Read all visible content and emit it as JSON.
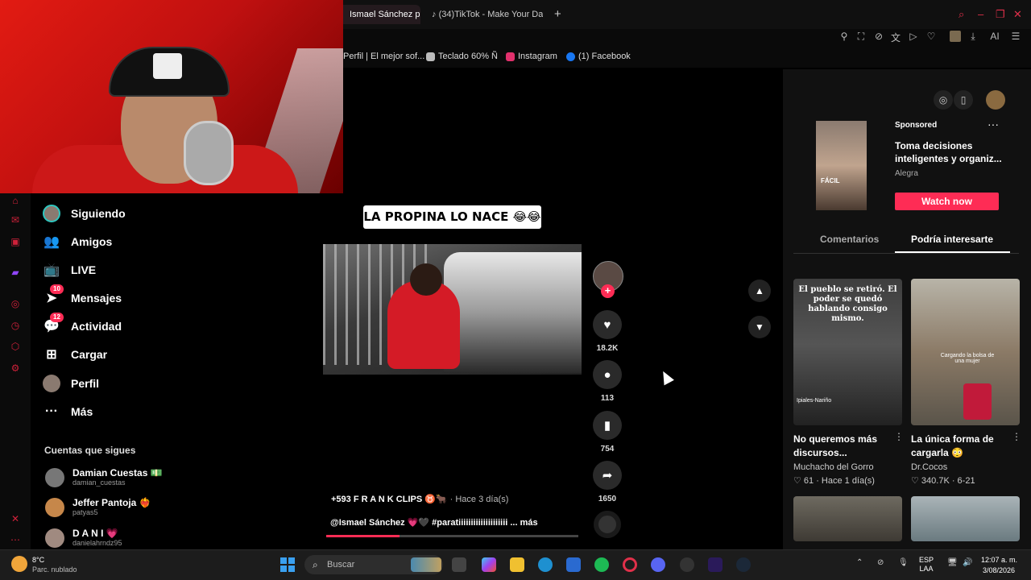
{
  "browser": {
    "tabs": [
      {
        "label": "Ismael Sánchez propina"
      },
      {
        "label": "(34)TikTok - Make Your Da"
      }
    ],
    "new_tab": "+",
    "bookmarks": [
      {
        "label": "Perfil | El mejor sof...",
        "color": "#444444"
      },
      {
        "label": "Teclado 60% Ñ",
        "color": "#bbbbbb"
      },
      {
        "label": "Instagram",
        "color": "#e1306c"
      },
      {
        "label": "(1) Facebook",
        "color": "#1877f2"
      }
    ],
    "toolbar_ai": "AI",
    "accent": "#e0304a"
  },
  "nav": {
    "items": [
      {
        "label": "Siguiendo",
        "icon": "avatar-icon"
      },
      {
        "label": "Amigos",
        "icon": "friends-icon"
      },
      {
        "label": "LIVE",
        "icon": "live-icon"
      },
      {
        "label": "Mensajes",
        "icon": "messages-icon",
        "badge": "10"
      },
      {
        "label": "Actividad",
        "icon": "activity-icon",
        "badge": "12"
      },
      {
        "label": "Cargar",
        "icon": "upload-icon"
      },
      {
        "label": "Perfil",
        "icon": "profile-icon"
      },
      {
        "label": "Más",
        "icon": "more-icon"
      }
    ],
    "following_title": "Cuentas que sigues",
    "accounts": [
      {
        "name": "Damian Cuestas 💵",
        "handle": "damian_cuestas"
      },
      {
        "name": "Jeffer Pantoja ❤️‍🔥",
        "handle": "patyas5"
      },
      {
        "name": "D A N I 💗",
        "handle": "danielahrndz95"
      }
    ]
  },
  "video": {
    "overlay_title": "LA PROPINA LO NACE 😂😂",
    "author": "+593 F R A N K CLIPS ♉🐂",
    "time": "· Hace 3 día(s)",
    "caption": "@Ismael Sánchez 💗🖤 #paratiiiiiiiiiiiiiiiiiiii ... más",
    "likes": "18.2K",
    "comments": "113",
    "saves": "754",
    "shares": "1650",
    "progress": 0.29,
    "brand_color": "#fe2c55"
  },
  "ad": {
    "sponsored": "Sponsored",
    "more": "···",
    "title": "Toma decisiones inteligentes y organiz...",
    "brand": "Alegra",
    "cta": "Watch now",
    "thumb_text": "FÁCIL"
  },
  "right_tabs": {
    "comments": "Comentarios",
    "interest": "Podría interesarte"
  },
  "related": [
    {
      "thumb_text": "El pueblo se retiró. El poder se quedó hablando consigo mismo.",
      "thumb_sub": "Ipiales-Nariño",
      "title": "No queremos más discursos...",
      "author": "Muchacho del Gorro",
      "stats": "♡ 61 · Hace 1 día(s)"
    },
    {
      "thumb_text": "",
      "thumb_sub": "Cargando la bolsa de una mujer",
      "title": "La única forma de cargarla 😳",
      "author": "Dr.Cocos",
      "stats": "♡ 340.7K · 6-21"
    }
  ],
  "taskbar": {
    "temp": "8°C",
    "weather": "Parc. nublado",
    "search_placeholder": "Buscar",
    "lang_top": "ESP",
    "lang_bottom": "LAA",
    "time": "12:07 a. m.",
    "date": "3/08/2026"
  }
}
